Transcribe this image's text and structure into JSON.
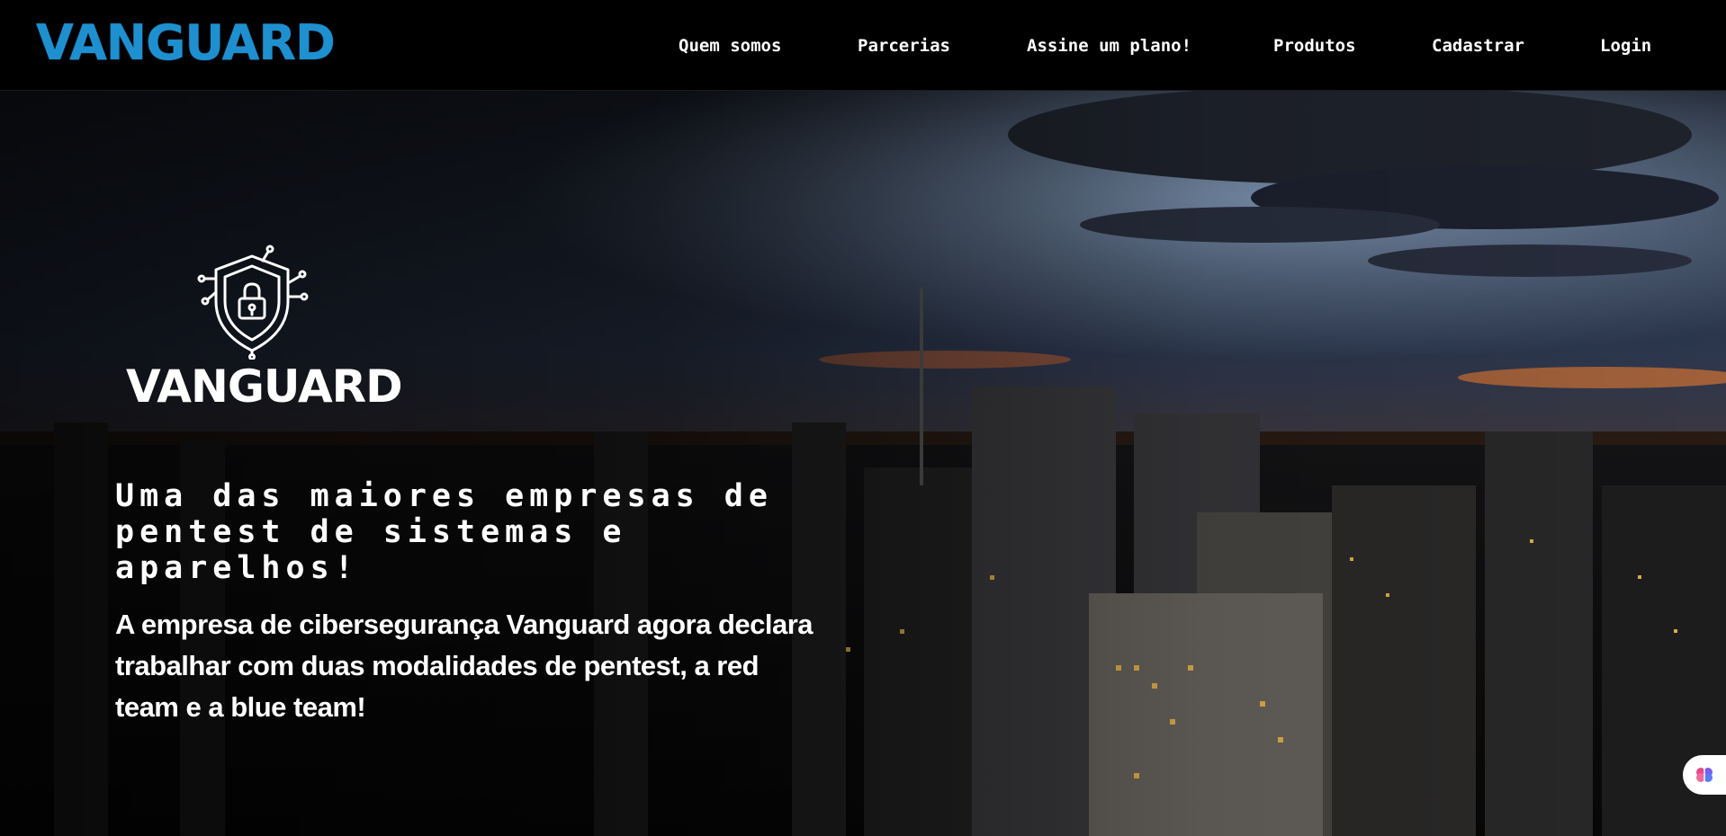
{
  "brand": {
    "name": "VANGUARD",
    "color": "#1e90d0"
  },
  "nav": {
    "items": [
      {
        "label": "Quem somos"
      },
      {
        "label": "Parcerias"
      },
      {
        "label": "Assine um plano!"
      },
      {
        "label": "Produtos"
      },
      {
        "label": "Cadastrar"
      },
      {
        "label": "Login"
      }
    ]
  },
  "hero": {
    "logo_icon": "shield-lock-circuit-icon",
    "logo_text": "VANGUARD",
    "headline": "Uma das maiores empresas de pentest de sistemas e aparelhos!",
    "subtext": "A empresa de cibersegurança Vanguard agora declara trabalhar com duas modalidades de pentest, a red team e a blue team!",
    "background": "night-city-skyline-image"
  },
  "assistant": {
    "icon": "brain-icon"
  }
}
